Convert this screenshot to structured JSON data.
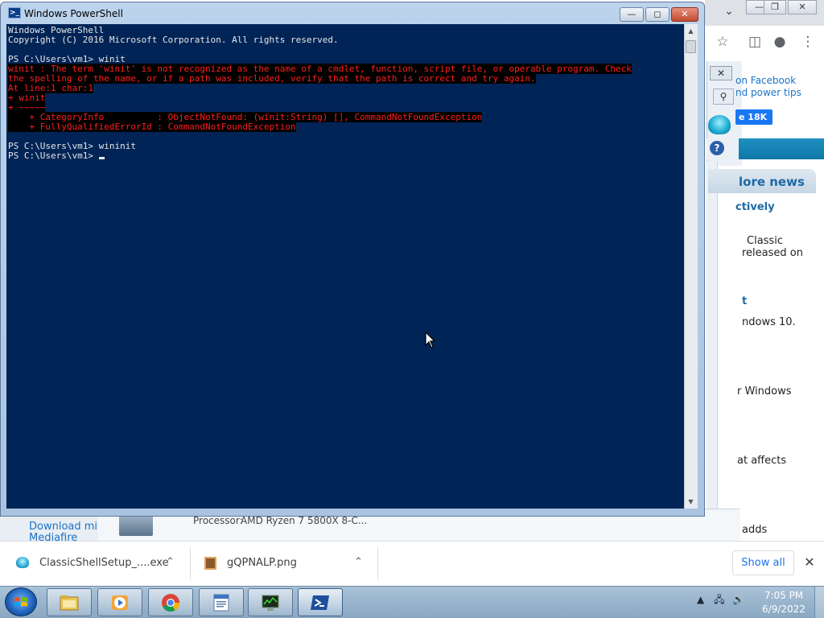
{
  "browser": {
    "facebook_text_1": "on Facebook",
    "facebook_text_2": "nd power tips",
    "like_label": "e 18K",
    "news_title": "lore news",
    "lines": [
      {
        "text": "ctively",
        "style": "bold-link"
      },
      {
        "text": "Classic",
        "style": "body-txt"
      },
      {
        "text": "released on",
        "style": "body-txt"
      },
      {
        "text": "t",
        "style": "bold-link"
      },
      {
        "text": "ndows 10.",
        "style": "body-txt"
      },
      {
        "text": "r Windows",
        "style": "body-txt"
      },
      {
        "text": "at affects",
        "style": "body-txt"
      },
      {
        "text": "adds",
        "style": "body-txt"
      }
    ],
    "download_mirror": "Download mirr",
    "mediafire": "Mediafire",
    "processor_label": "Processor:",
    "processor_value": "AMD Ryzen 7 5800X 8-C..."
  },
  "downloads": {
    "items": [
      {
        "name": "ClassicShellSetup_....exe"
      },
      {
        "name": "gQPNALP.png"
      }
    ],
    "show_all": "Show all"
  },
  "powershell": {
    "title": "Windows PowerShell",
    "lines": [
      {
        "text": "Windows PowerShell",
        "err": false
      },
      {
        "text": "Copyright (C) 2016 Microsoft Corporation. All rights reserved.",
        "err": false
      },
      {
        "text": "",
        "err": false
      },
      {
        "text": "PS C:\\Users\\vm1> winit",
        "err": false
      },
      {
        "text": "winit : The term 'winit' is not recognized as the name of a cmdlet, function, script file, or operable program. Check",
        "err": true
      },
      {
        "text": "the spelling of the name, or if a path was included, verify that the path is correct and try again.",
        "err": true
      },
      {
        "text": "At line:1 char:1",
        "err": true
      },
      {
        "text": "+ winit",
        "err": true
      },
      {
        "text": "+ ~~~~~",
        "err": true
      },
      {
        "text": "    + CategoryInfo          : ObjectNotFound: (winit:String) [], CommandNotFoundException",
        "err": true
      },
      {
        "text": "    + FullyQualifiedErrorId : CommandNotFoundException",
        "err": true
      },
      {
        "text": "",
        "err": false
      },
      {
        "text": "PS C:\\Users\\vm1> wininit",
        "err": false
      },
      {
        "text": "PS C:\\Users\\vm1> ",
        "err": false,
        "cursor": true
      }
    ]
  },
  "taskbar": {
    "apps": [
      {
        "icon": "file-explorer-icon"
      },
      {
        "icon": "media-player-icon"
      },
      {
        "icon": "chrome-icon"
      },
      {
        "icon": "wordpad-icon"
      },
      {
        "icon": "task-manager-icon"
      },
      {
        "icon": "powershell-icon",
        "active": true
      }
    ],
    "time": "7:05 PM",
    "date": "6/9/2022"
  },
  "colors": {
    "console_bg": "#012456",
    "console_error": "#ff1e1e",
    "console_text": "#e8e8e8"
  }
}
